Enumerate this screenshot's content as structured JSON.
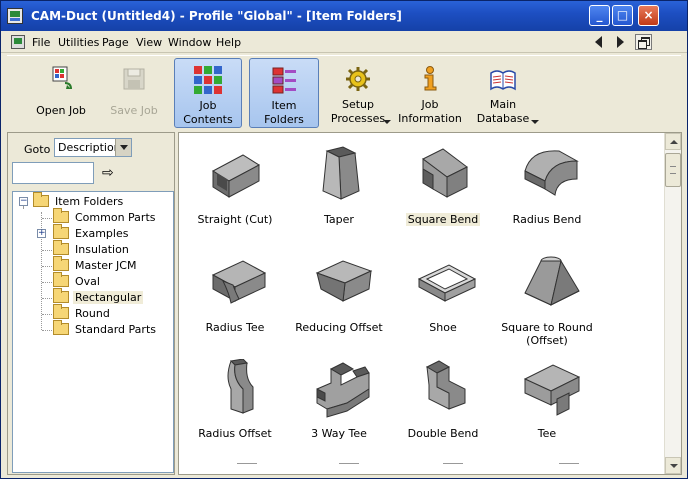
{
  "window": {
    "title": "CAM-Duct (Untitled4) - Profile \"Global\" - [Item Folders]",
    "controls": {
      "minimize": "_",
      "maximize": "□",
      "close": "×"
    }
  },
  "menu": {
    "items": [
      "File",
      "Utilities",
      "Page",
      "View",
      "Window",
      "Help"
    ]
  },
  "toolbar": {
    "buttons": [
      {
        "label": "Open Job",
        "icon": "open-job-icon"
      },
      {
        "label": "Save Job",
        "icon": "save-job-icon",
        "disabled": true
      },
      {
        "label": "Job Contents",
        "icon": "job-contents-icon",
        "active": true
      },
      {
        "label": "Item Folders",
        "icon": "item-folders-icon",
        "active": true
      },
      {
        "label": "Setup Processes",
        "icon": "setup-processes-icon",
        "dropdown": true
      },
      {
        "label": "Job Information",
        "icon": "job-information-icon"
      },
      {
        "label": "Main Database",
        "icon": "main-database-icon",
        "dropdown": true
      }
    ]
  },
  "left": {
    "goto_label": "Goto",
    "goto_value": "Description",
    "search_value": "",
    "tree": {
      "root": "Item Folders",
      "children": [
        "Common Parts",
        "Examples",
        "Insulation",
        "Master JCM",
        "Oval",
        "Rectangular",
        "Round",
        "Standard Parts"
      ],
      "selected": "Rectangular",
      "expandable": [
        "Examples"
      ]
    }
  },
  "items": [
    {
      "label": "Straight (Cut)"
    },
    {
      "label": "Taper"
    },
    {
      "label": "Square Bend",
      "selected": true
    },
    {
      "label": "Radius Bend"
    },
    {
      "label": "Radius Tee"
    },
    {
      "label": "Reducing Offset"
    },
    {
      "label": "Shoe"
    },
    {
      "label": "Square to Round (Offset)"
    },
    {
      "label": "Radius Offset"
    },
    {
      "label": "3 Way Tee"
    },
    {
      "label": "Double Bend"
    },
    {
      "label": "Tee"
    }
  ],
  "colors": {
    "titlebar": "#1d4fc2",
    "part_gray": "#8a8a8a",
    "selection": "#f0ecd8",
    "folder": "#f6d676"
  }
}
